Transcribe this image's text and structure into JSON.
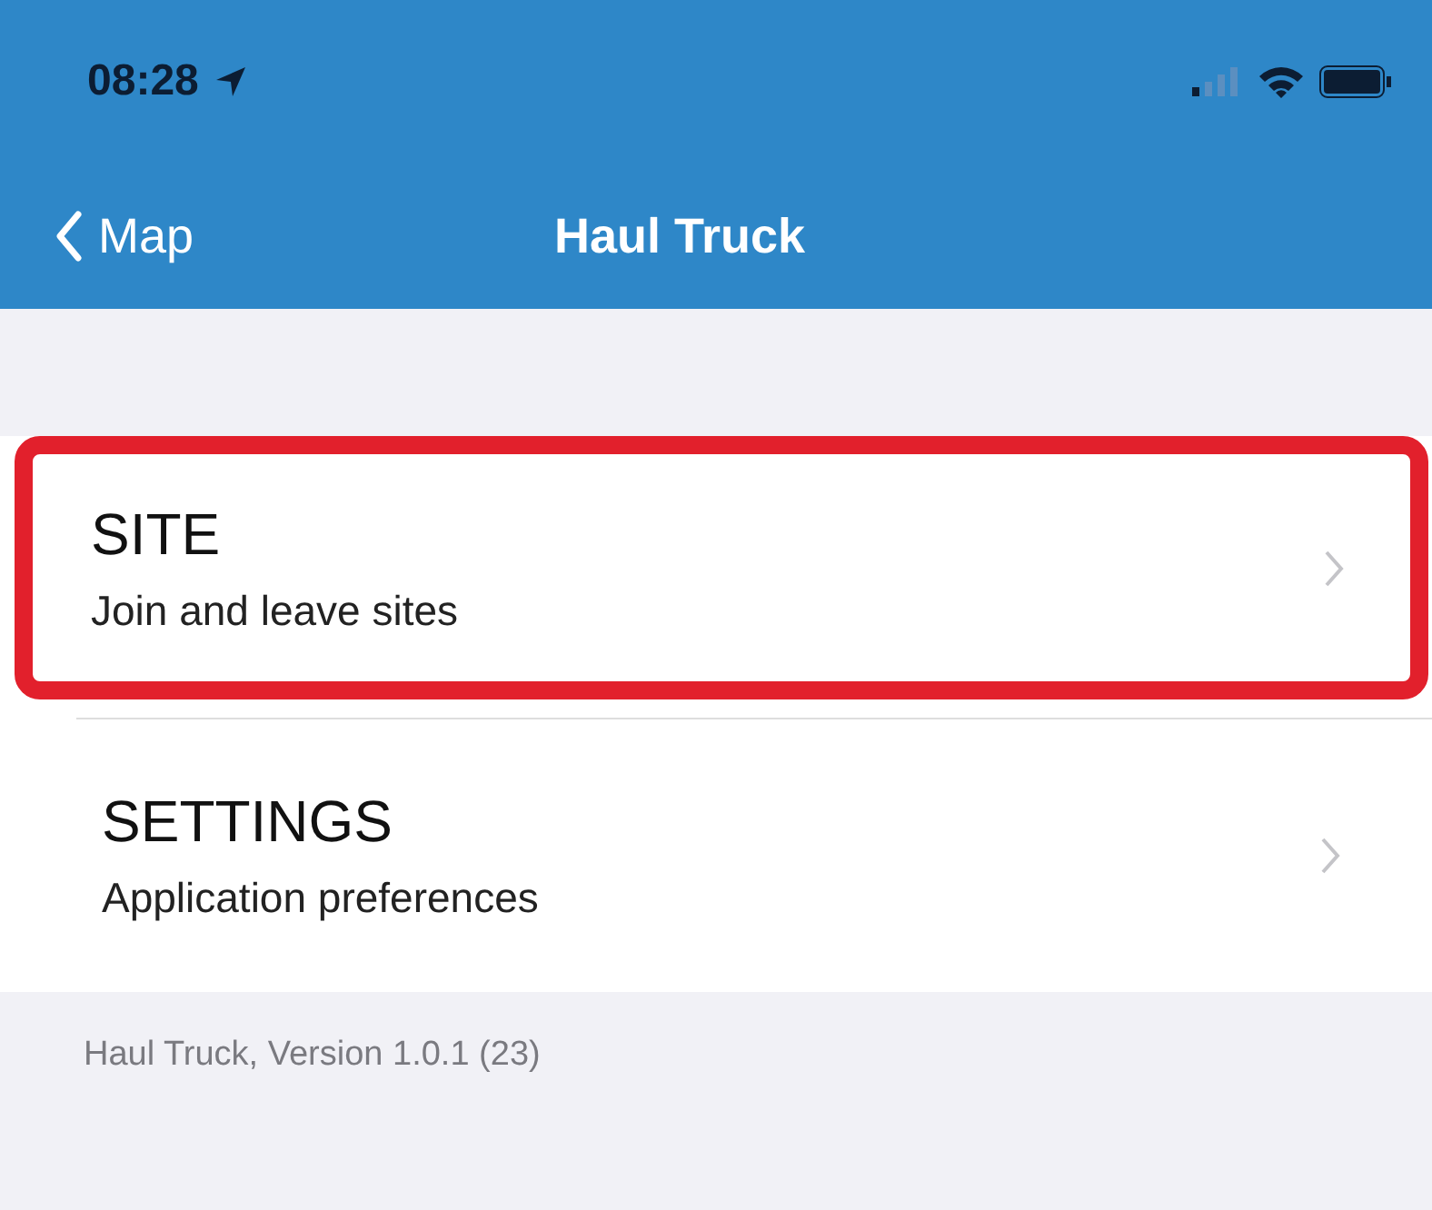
{
  "status_bar": {
    "time": "08:28"
  },
  "nav": {
    "back": "Map",
    "title": "Haul Truck"
  },
  "items": [
    {
      "title": "SITE",
      "subtitle": "Join and leave sites",
      "highlighted": true
    },
    {
      "title": "SETTINGS",
      "subtitle": "Application preferences",
      "highlighted": false
    }
  ],
  "footer": "Haul Truck, Version 1.0.1 (23)"
}
